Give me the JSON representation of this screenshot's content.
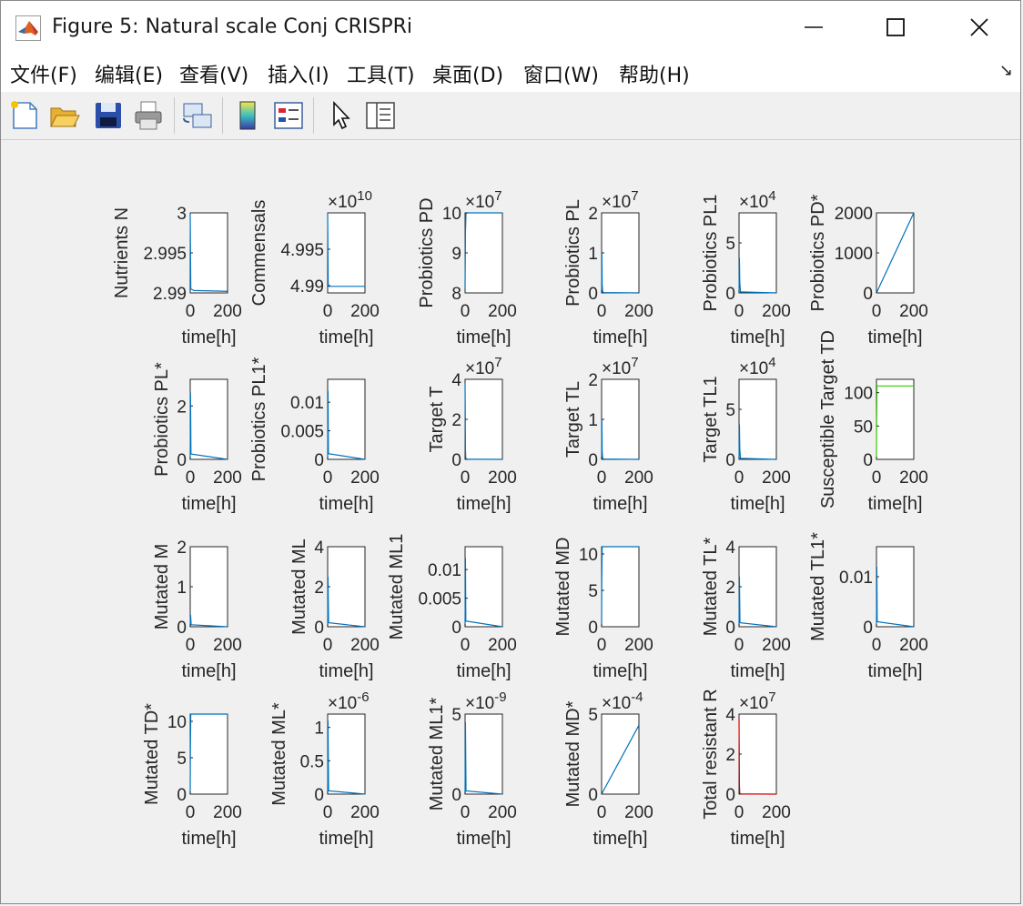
{
  "window": {
    "title": "Figure 5: Natural scale Conj CRISPRi",
    "minimize_icon": "minimize-icon",
    "maximize_icon": "maximize-icon",
    "close_icon": "close-icon"
  },
  "menu": [
    {
      "label": "文件(F)",
      "mnemonic": "F"
    },
    {
      "label": "编辑(E)",
      "mnemonic": "E"
    },
    {
      "label": "查看(V)",
      "mnemonic": "V"
    },
    {
      "label": "插入(I)",
      "mnemonic": "I"
    },
    {
      "label": "工具(T)",
      "mnemonic": "T"
    },
    {
      "label": "桌面(D)",
      "mnemonic": "D"
    },
    {
      "label": "窗口(W)",
      "mnemonic": "W"
    },
    {
      "label": "帮助(H)",
      "mnemonic": "H"
    }
  ],
  "toolbar": [
    "new-figure-icon",
    "open-file-icon",
    "save-icon",
    "print-icon",
    "link-plot-icon",
    "colorbar-icon",
    "legend-icon",
    "edit-plot-pointer-icon",
    "property-inspector-icon"
  ],
  "colors": {
    "series_blue": "#0072bd",
    "series_green": "#33cc00",
    "series_red": "#e00000"
  },
  "chart_data": [
    {
      "type": "line",
      "ylabel": "Nutrients N",
      "xlabel": "time[h]",
      "xticks": [
        "0",
        "200"
      ],
      "xlim": [
        0,
        200
      ],
      "ylim": [
        2.99,
        3
      ],
      "yticks": [
        "2.99",
        "2.995",
        "3"
      ],
      "exponent": "",
      "series": [
        {
          "x": [
            0,
            3,
            20,
            200
          ],
          "y": [
            3,
            2.9905,
            2.9903,
            2.9902
          ]
        }
      ]
    },
    {
      "type": "line",
      "ylabel": "Commensals",
      "xlabel": "time[h]",
      "xticks": [
        "0",
        "200"
      ],
      "xlim": [
        0,
        200
      ],
      "ylim": [
        4.989,
        5
      ],
      "yticks": [
        "4.99",
        "4.995"
      ],
      "exponent": "10",
      "series": [
        {
          "x": [
            0,
            3,
            200
          ],
          "y": [
            5,
            4.9899,
            4.9899
          ]
        }
      ]
    },
    {
      "type": "line",
      "ylabel": "Probiotics PD",
      "xlabel": "time[h]",
      "xticks": [
        "0",
        "200"
      ],
      "xlim": [
        0,
        200
      ],
      "ylim": [
        8,
        10
      ],
      "yticks": [
        "8",
        "9",
        "10"
      ],
      "exponent": "7",
      "series": [
        {
          "x": [
            0,
            2,
            5,
            200
          ],
          "y": [
            8.1,
            9.5,
            10,
            10
          ]
        }
      ]
    },
    {
      "type": "line",
      "ylabel": "Probiotics PL",
      "xlabel": "time[h]",
      "xticks": [
        "0",
        "200"
      ],
      "xlim": [
        0,
        200
      ],
      "ylim": [
        0,
        2
      ],
      "yticks": [
        "0",
        "1",
        "2"
      ],
      "exponent": "7",
      "series": [
        {
          "x": [
            0,
            1.5,
            3,
            6,
            200
          ],
          "y": [
            0,
            1.0,
            0.2,
            0.01,
            0
          ]
        }
      ]
    },
    {
      "type": "line",
      "ylabel": "Probiotics PL1",
      "xlabel": "time[h]",
      "xticks": [
        "0",
        "200"
      ],
      "xlim": [
        0,
        200
      ],
      "ylim": [
        0,
        8
      ],
      "yticks": [
        "0",
        "5"
      ],
      "exponent": "4",
      "series": [
        {
          "x": [
            0,
            2,
            4,
            8,
            200
          ],
          "y": [
            0,
            3.5,
            1,
            0.1,
            0
          ]
        }
      ]
    },
    {
      "type": "line",
      "ylabel": "Probiotics PD*",
      "xlabel": "time[h]",
      "xticks": [
        "0",
        "200"
      ],
      "xlim": [
        0,
        200
      ],
      "ylim": [
        0,
        2000
      ],
      "yticks": [
        "0",
        "1000",
        "2000"
      ],
      "exponent": "",
      "series": [
        {
          "x": [
            0,
            200
          ],
          "y": [
            0,
            2000
          ]
        }
      ]
    },
    {
      "type": "line",
      "ylabel": "Probiotics PL*",
      "xlabel": "time[h]",
      "xticks": [
        "0",
        "200"
      ],
      "xlim": [
        0,
        200
      ],
      "ylim": [
        0,
        3
      ],
      "yticks": [
        "0",
        "2"
      ],
      "exponent": "",
      "series": [
        {
          "x": [
            0,
            1.5,
            4,
            200
          ],
          "y": [
            0,
            2.5,
            0.2,
            0
          ]
        }
      ]
    },
    {
      "type": "line",
      "ylabel": "Probiotics PL1*",
      "xlabel": "time[h]",
      "xticks": [
        "0",
        "200"
      ],
      "xlim": [
        0,
        200
      ],
      "ylim": [
        0,
        0.014
      ],
      "yticks": [
        "0",
        "0.005",
        "0.01"
      ],
      "exponent": "",
      "series": [
        {
          "x": [
            0,
            2,
            4,
            200
          ],
          "y": [
            0,
            0.012,
            0.001,
            0
          ]
        }
      ]
    },
    {
      "type": "line",
      "ylabel": "Target T",
      "xlabel": "time[h]",
      "xticks": [
        "0",
        "200"
      ],
      "xlim": [
        0,
        200
      ],
      "ylim": [
        0,
        4
      ],
      "yticks": [
        "0",
        "2",
        "4"
      ],
      "exponent": "7",
      "series": [
        {
          "x": [
            0,
            2,
            4,
            200
          ],
          "y": [
            3.8,
            0.5,
            0.01,
            0
          ]
        }
      ]
    },
    {
      "type": "line",
      "ylabel": "Target TL",
      "xlabel": "time[h]",
      "xticks": [
        "0",
        "200"
      ],
      "xlim": [
        0,
        200
      ],
      "ylim": [
        0,
        2
      ],
      "yticks": [
        "0",
        "1",
        "2"
      ],
      "exponent": "7",
      "series": [
        {
          "x": [
            0,
            1.5,
            3,
            6,
            200
          ],
          "y": [
            0,
            1.0,
            0.2,
            0.01,
            0
          ]
        }
      ]
    },
    {
      "type": "line",
      "ylabel": "Target TL1",
      "xlabel": "time[h]",
      "xticks": [
        "0",
        "200"
      ],
      "xlim": [
        0,
        200
      ],
      "ylim": [
        0,
        8
      ],
      "yticks": [
        "0",
        "5"
      ],
      "exponent": "4",
      "series": [
        {
          "x": [
            0,
            2,
            4,
            8,
            200
          ],
          "y": [
            0,
            3.5,
            1,
            0.1,
            0
          ]
        }
      ]
    },
    {
      "type": "line",
      "ylabel": "Susceptible Target TD",
      "xlabel": "time[h]",
      "xticks": [
        "0",
        "200"
      ],
      "xlim": [
        0,
        200
      ],
      "ylim": [
        0,
        120
      ],
      "yticks": [
        "0",
        "50",
        "100"
      ],
      "exponent": "",
      "series": [
        {
          "x": [
            0,
            1,
            3,
            200
          ],
          "y": [
            0,
            60,
            110,
            110
          ],
          "color": "green"
        }
      ]
    },
    {
      "type": "line",
      "ylabel": "Mutated M",
      "xlabel": "time[h]",
      "xticks": [
        "0",
        "200"
      ],
      "xlim": [
        0,
        200
      ],
      "ylim": [
        0,
        2
      ],
      "yticks": [
        "0",
        "1",
        "2"
      ],
      "exponent": "",
      "series": [
        {
          "x": [
            0,
            2,
            5,
            200
          ],
          "y": [
            0,
            0.3,
            0.05,
            0
          ]
        }
      ]
    },
    {
      "type": "line",
      "ylabel": "Mutated ML",
      "xlabel": "time[h]",
      "xticks": [
        "0",
        "200"
      ],
      "xlim": [
        0,
        200
      ],
      "ylim": [
        0,
        4
      ],
      "yticks": [
        "0",
        "2",
        "4"
      ],
      "exponent": "",
      "series": [
        {
          "x": [
            0,
            2,
            5,
            200
          ],
          "y": [
            0,
            2.5,
            0.2,
            0
          ]
        }
      ]
    },
    {
      "type": "line",
      "ylabel": "Mutated ML1",
      "xlabel": "time[h]",
      "xticks": [
        "0",
        "200"
      ],
      "xlim": [
        0,
        200
      ],
      "ylim": [
        0,
        0.014
      ],
      "yticks": [
        "0",
        "0.005",
        "0.01"
      ],
      "exponent": "",
      "series": [
        {
          "x": [
            0,
            2,
            4,
            200
          ],
          "y": [
            0,
            0.012,
            0.001,
            0
          ]
        }
      ]
    },
    {
      "type": "line",
      "ylabel": "Mutated MD",
      "xlabel": "time[h]",
      "xticks": [
        "0",
        "200"
      ],
      "xlim": [
        0,
        200
      ],
      "ylim": [
        0,
        11
      ],
      "yticks": [
        "0",
        "5",
        "10"
      ],
      "exponent": "",
      "series": [
        {
          "x": [
            0,
            1,
            3,
            200
          ],
          "y": [
            0,
            6,
            11,
            11
          ]
        }
      ]
    },
    {
      "type": "line",
      "ylabel": "Mutated TL*",
      "xlabel": "time[h]",
      "xticks": [
        "0",
        "200"
      ],
      "xlim": [
        0,
        200
      ],
      "ylim": [
        0,
        4
      ],
      "yticks": [
        "0",
        "2",
        "4"
      ],
      "exponent": "",
      "series": [
        {
          "x": [
            0,
            2,
            5,
            200
          ],
          "y": [
            0,
            2.5,
            0.2,
            0
          ]
        }
      ]
    },
    {
      "type": "line",
      "ylabel": "Mutated TL1*",
      "xlabel": "time[h]",
      "xticks": [
        "0",
        "200"
      ],
      "xlim": [
        0,
        200
      ],
      "ylim": [
        0,
        0.016
      ],
      "yticks": [
        "0",
        "0.01"
      ],
      "exponent": "",
      "series": [
        {
          "x": [
            0,
            2,
            4,
            200
          ],
          "y": [
            0,
            0.012,
            0.001,
            0
          ]
        }
      ]
    },
    {
      "type": "line",
      "ylabel": "Mutated TD*",
      "xlabel": "time[h]",
      "xticks": [
        "0",
        "200"
      ],
      "xlim": [
        0,
        200
      ],
      "ylim": [
        0,
        11
      ],
      "yticks": [
        "0",
        "5",
        "10"
      ],
      "exponent": "",
      "series": [
        {
          "x": [
            0,
            1,
            3,
            200
          ],
          "y": [
            0,
            6,
            11,
            11
          ]
        }
      ]
    },
    {
      "type": "line",
      "ylabel": "Mutated ML*",
      "xlabel": "time[h]",
      "xticks": [
        "0",
        "200"
      ],
      "xlim": [
        0,
        200
      ],
      "ylim": [
        0,
        1.2
      ],
      "yticks": [
        "0",
        "0.5",
        "1"
      ],
      "exponent": "-6",
      "series": [
        {
          "x": [
            0,
            2,
            5,
            200
          ],
          "y": [
            0,
            1.1,
            0.05,
            0
          ]
        }
      ]
    },
    {
      "type": "line",
      "ylabel": "Mutated ML1*",
      "xlabel": "time[h]",
      "xticks": [
        "0",
        "200"
      ],
      "xlim": [
        0,
        200
      ],
      "ylim": [
        0,
        5
      ],
      "yticks": [
        "0",
        "5"
      ],
      "exponent": "-9",
      "series": [
        {
          "x": [
            0,
            2,
            5,
            200
          ],
          "y": [
            0,
            4.5,
            0.2,
            0
          ]
        }
      ]
    },
    {
      "type": "line",
      "ylabel": "Mutated MD*",
      "xlabel": "time[h]",
      "xticks": [
        "0",
        "200"
      ],
      "xlim": [
        0,
        200
      ],
      "ylim": [
        0,
        5
      ],
      "yticks": [
        "0",
        "5"
      ],
      "exponent": "-4",
      "series": [
        {
          "x": [
            0,
            200
          ],
          "y": [
            0,
            4.3
          ]
        }
      ]
    },
    {
      "type": "line",
      "ylabel": "Total resistant R",
      "xlabel": "time[h]",
      "xticks": [
        "0",
        "200"
      ],
      "xlim": [
        0,
        200
      ],
      "ylim": [
        0,
        4
      ],
      "yticks": [
        "0",
        "2",
        "4"
      ],
      "exponent": "7",
      "series": [
        {
          "x": [
            0,
            2,
            4,
            200
          ],
          "y": [
            3.8,
            0.5,
            0.01,
            0
          ],
          "color": "red"
        }
      ]
    }
  ]
}
